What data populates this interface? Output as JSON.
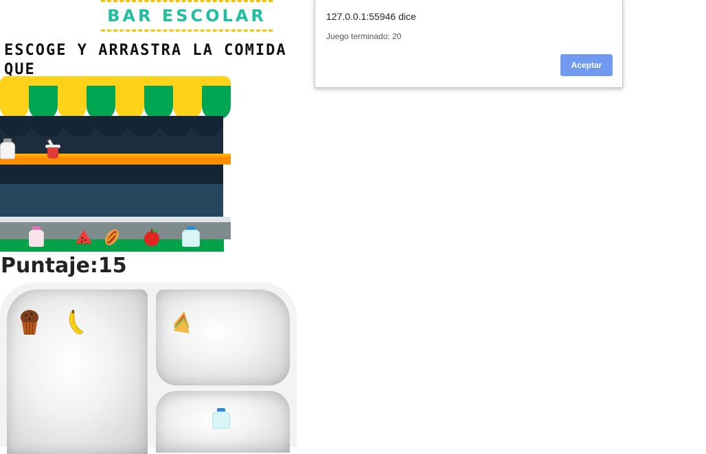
{
  "header": {
    "title": "BAR ESCOLAR",
    "instructions": "ESCOGE Y ARRASTRA LA COMIDA QUE\nNECESITA TU CUERPO"
  },
  "game": {
    "score_label": "Puntaje:",
    "score_value": "15",
    "stall_items": [
      {
        "name": "milk-bottle",
        "icon": "bottle"
      },
      {
        "name": "yogurt-cup",
        "icon": "cup"
      },
      {
        "name": "strawberry-milk",
        "icon": "bottle"
      },
      {
        "name": "watermelon",
        "icon": "watermelon"
      },
      {
        "name": "hot-dog",
        "icon": "hot-dog"
      },
      {
        "name": "apple",
        "icon": "apple"
      },
      {
        "name": "water-bottle",
        "icon": "bottle"
      }
    ],
    "tray_items": [
      {
        "name": "muffin",
        "icon": "muffin"
      },
      {
        "name": "banana",
        "icon": "banana"
      },
      {
        "name": "sandwich",
        "icon": "sandwich"
      },
      {
        "name": "water-bottle",
        "icon": "bottle"
      }
    ]
  },
  "dialog": {
    "title": "127.0.0.1:55946 dice",
    "message": "Juego terminado: 20",
    "ok_label": "Aceptar"
  },
  "colors": {
    "title": "#1fbf9f",
    "awning_yellow": "#ffd21a",
    "awning_green": "#00a651",
    "shelf_orange": "#ff8f00",
    "dialog_button": "#6f9af0"
  }
}
